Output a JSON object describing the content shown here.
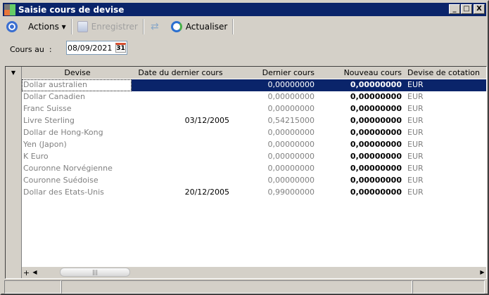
{
  "window": {
    "title": "Saisie cours de devise",
    "minimize": "_",
    "maximize": "□",
    "close": "X"
  },
  "toolbar": {
    "actions": "Actions ▾",
    "save": "Enregistrer",
    "refresh": "Actualiser"
  },
  "filter": {
    "label": "Cours au  :",
    "date": "08/09/2021",
    "calendar": "31"
  },
  "grid": {
    "columns": [
      "Devise",
      "Date du dernier cours",
      "Dernier cours",
      "Nouveau cours",
      "Devise de cotation"
    ],
    "rows": [
      [
        "Dollar australien",
        "",
        "0,00000000",
        "0,00000000",
        "EUR"
      ],
      [
        "Dollar Canadien",
        "",
        "0,00000000",
        "0,00000000",
        "EUR"
      ],
      [
        "Franc Suisse",
        "",
        "0,00000000",
        "0,00000000",
        "EUR"
      ],
      [
        "Livre Sterling",
        "03/12/2005",
        "0,54215000",
        "0,00000000",
        "EUR"
      ],
      [
        "Dollar de Hong-Kong",
        "",
        "0,00000000",
        "0,00000000",
        "EUR"
      ],
      [
        "Yen (Japon)",
        "",
        "0,00000000",
        "0,00000000",
        "EUR"
      ],
      [
        "K Euro",
        "",
        "0,00000000",
        "0,00000000",
        "EUR"
      ],
      [
        "Couronne Norvégienne",
        "",
        "0,00000000",
        "0,00000000",
        "EUR"
      ],
      [
        "Couronne Suédoise",
        "",
        "0,00000000",
        "0,00000000",
        "EUR"
      ],
      [
        "Dollar des Etats-Unis",
        "20/12/2005",
        "0,99000000",
        "0,00000000",
        "EUR"
      ]
    ],
    "selected_row": 0,
    "add_row": "+"
  }
}
